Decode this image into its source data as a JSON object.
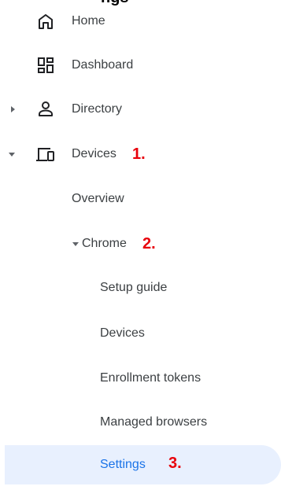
{
  "header_partial": "ngs",
  "nav": {
    "home": "Home",
    "dashboard": "Dashboard",
    "directory": "Directory",
    "devices": "Devices",
    "overview": "Overview",
    "chrome": "Chrome",
    "setup_guide": "Setup guide",
    "chrome_devices": "Devices",
    "enrollment_tokens": "Enrollment tokens",
    "managed_browsers": "Managed browsers",
    "settings": "Settings"
  },
  "annotations": {
    "one": "1.",
    "two": "2.",
    "three": "3."
  },
  "colors": {
    "active_bg": "#e8f0fe",
    "active_text": "#1a73e8",
    "annotation": "#e8000b"
  }
}
